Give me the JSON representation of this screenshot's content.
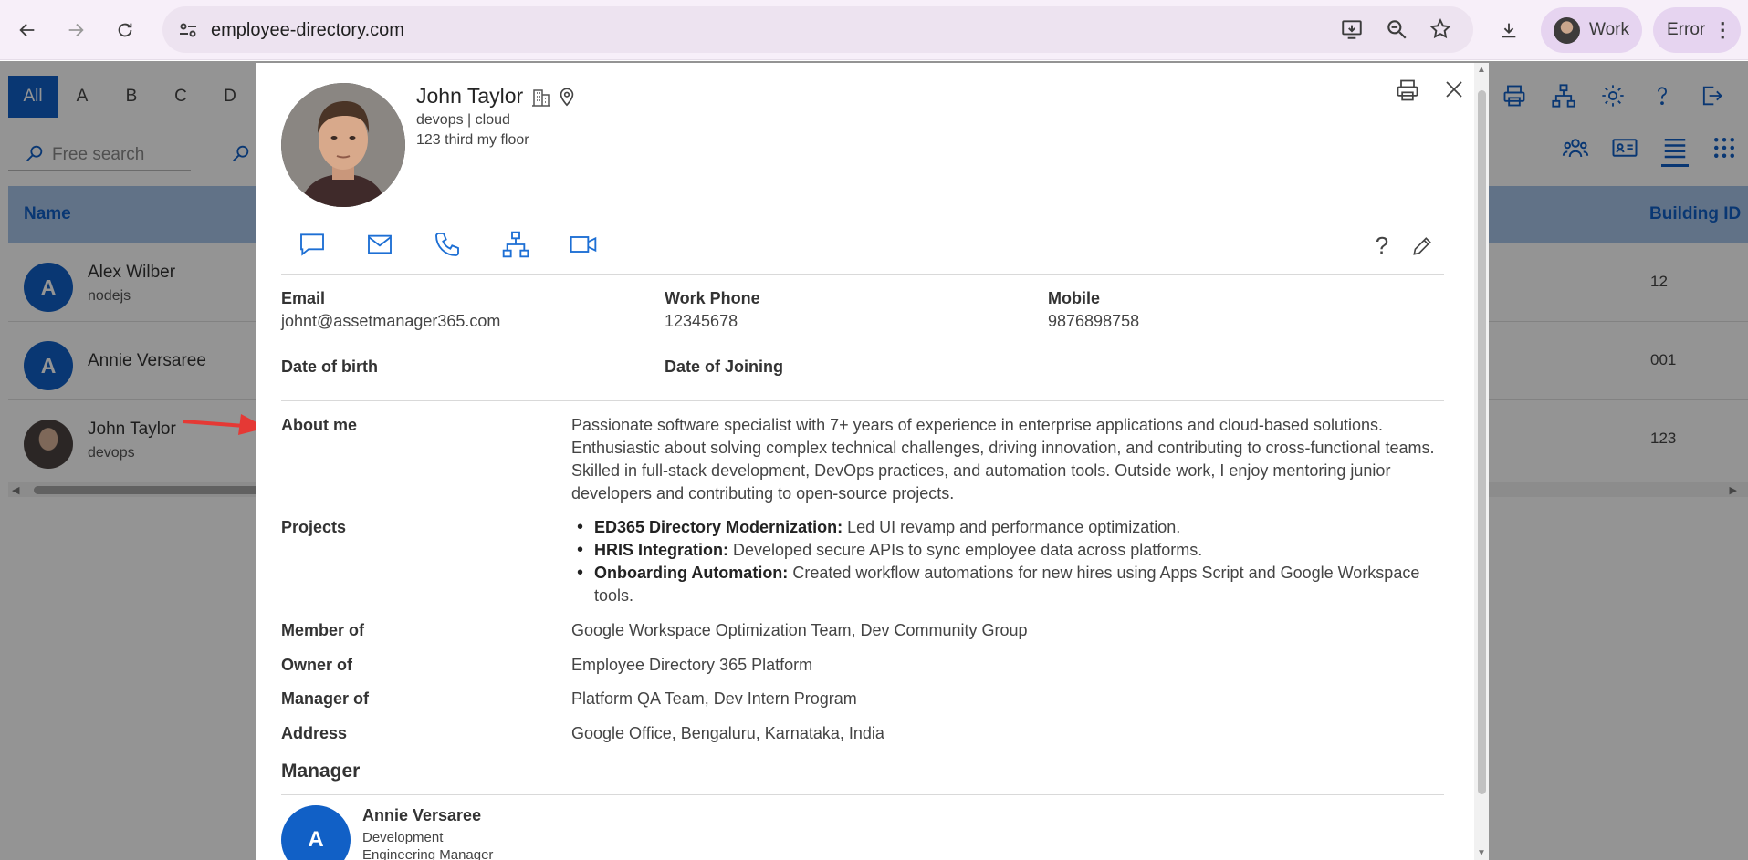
{
  "browser": {
    "url": "employee-directory.com",
    "profile_label": "Work",
    "error_label": "Error"
  },
  "app": {
    "alphabet": [
      "All",
      "A",
      "B",
      "C",
      "D"
    ],
    "search_placeholder": "Free search",
    "columns": {
      "name": "Name",
      "building": "Building ID"
    },
    "rows": [
      {
        "name": "Alex Wilber",
        "sub": "nodejs",
        "initial": "A",
        "building": "12"
      },
      {
        "name": "Annie Versaree",
        "sub": "",
        "initial": "A",
        "building": "001"
      },
      {
        "name": "John Taylor",
        "sub": "devops",
        "initial": "",
        "building": "123"
      }
    ]
  },
  "profile": {
    "name": "John Taylor",
    "title_line": "devops | cloud",
    "office_line": "123 third my floor",
    "contact": {
      "email_label": "Email",
      "email": "johnt@assetmanager365.com",
      "work_phone_label": "Work Phone",
      "work_phone": "12345678",
      "mobile_label": "Mobile",
      "mobile": "9876898758",
      "dob_label": "Date of birth",
      "doj_label": "Date of Joining"
    },
    "about_label": "About me",
    "about": "Passionate software specialist with 7+ years of experience in enterprise applications and cloud-based solutions. Enthusiastic about solving complex technical challenges, driving innovation, and contributing to cross-functional teams. Skilled in full-stack development, DevOps practices, and automation tools. Outside work, I enjoy mentoring junior developers and contributing to open-source projects.",
    "projects_label": "Projects",
    "projects": [
      {
        "title": "ED365 Directory Modernization:",
        "desc": "Led UI revamp and performance optimization."
      },
      {
        "title": "HRIS Integration:",
        "desc": "Developed secure APIs to sync employee data across platforms."
      },
      {
        "title": "Onboarding Automation:",
        "desc": "Created workflow automations for new hires using Apps Script and Google Workspace tools."
      }
    ],
    "member_of_label": "Member of",
    "member_of": "Google Workspace Optimization Team, Dev Community Group",
    "owner_of_label": "Owner of",
    "owner_of": "Employee Directory 365 Platform",
    "manager_of_label": "Manager of",
    "manager_of": "Platform QA Team, Dev Intern Program",
    "address_label": "Address",
    "address": "Google Office, Bengaluru, Karnataka, India",
    "manager_section": "Manager",
    "manager": {
      "initial": "A",
      "name": "Annie Versaree",
      "department": "Development",
      "role": "Engineering Manager"
    }
  },
  "colors": {
    "accent": "#1160c6",
    "header_bg": "#a7c4e9",
    "annotation_arrow": "#e53935"
  }
}
